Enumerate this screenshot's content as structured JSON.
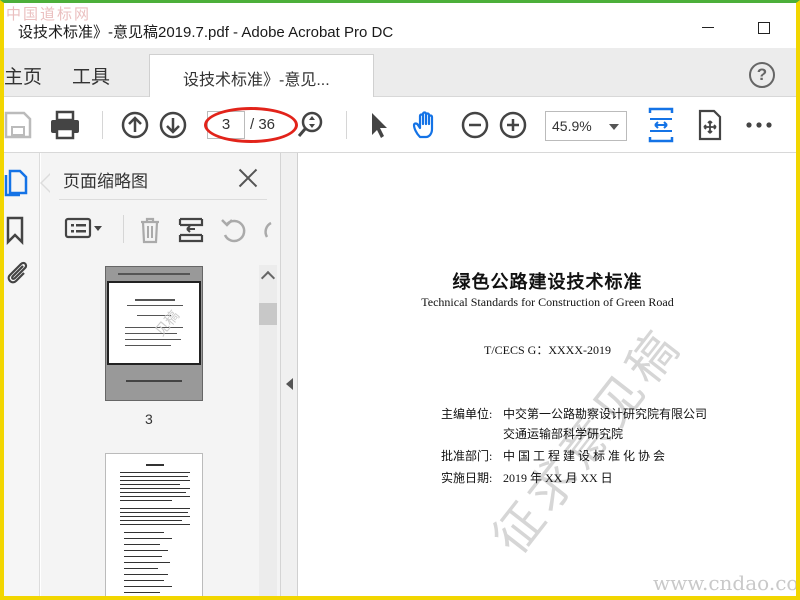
{
  "window": {
    "title": "设技术标准》-意见稿2019.7.pdf - Adobe Acrobat Pro DC",
    "watermark_corner": "中国道标网"
  },
  "tabs": {
    "home": "主页",
    "tools": "工具",
    "document": "设技术标准》-意见..."
  },
  "help": {
    "label": "?"
  },
  "toolbar": {
    "page_current": "3",
    "page_total": "/ 36",
    "zoom": "45.9%",
    "icons": [
      "save-icon",
      "print-icon",
      "prev-page-icon",
      "next-page-icon",
      "zoom-search-icon",
      "select-arrow-icon",
      "hand-icon",
      "zoom-out-icon",
      "zoom-in-icon",
      "fit-page-icon",
      "scroll-mode-icon",
      "more-icon"
    ],
    "accent": "#1473e6",
    "highlight": "#e2231a"
  },
  "thumbnails": {
    "title": "页面缩略图",
    "page_label": "3",
    "thumb_watermark": "见稿"
  },
  "document": {
    "title": "绿色公路建设技术标准",
    "subtitle": "Technical Standards for Construction of Green Road",
    "code": "T/CECS G：XXXX-2019",
    "editor_label": "主编单位:",
    "editor_1": "中交第一公路勘察设计研究院有限公司",
    "editor_2": "交通运输部科学研究院",
    "approver_label": "批准部门:",
    "approver": "中 国 工 程 建 设 标 准 化 协 会",
    "date_label": "实施日期:",
    "date": "2019 年 XX 月 XX 日",
    "watermark": "征求意见稿",
    "site_watermark": "www.cndao.com"
  }
}
